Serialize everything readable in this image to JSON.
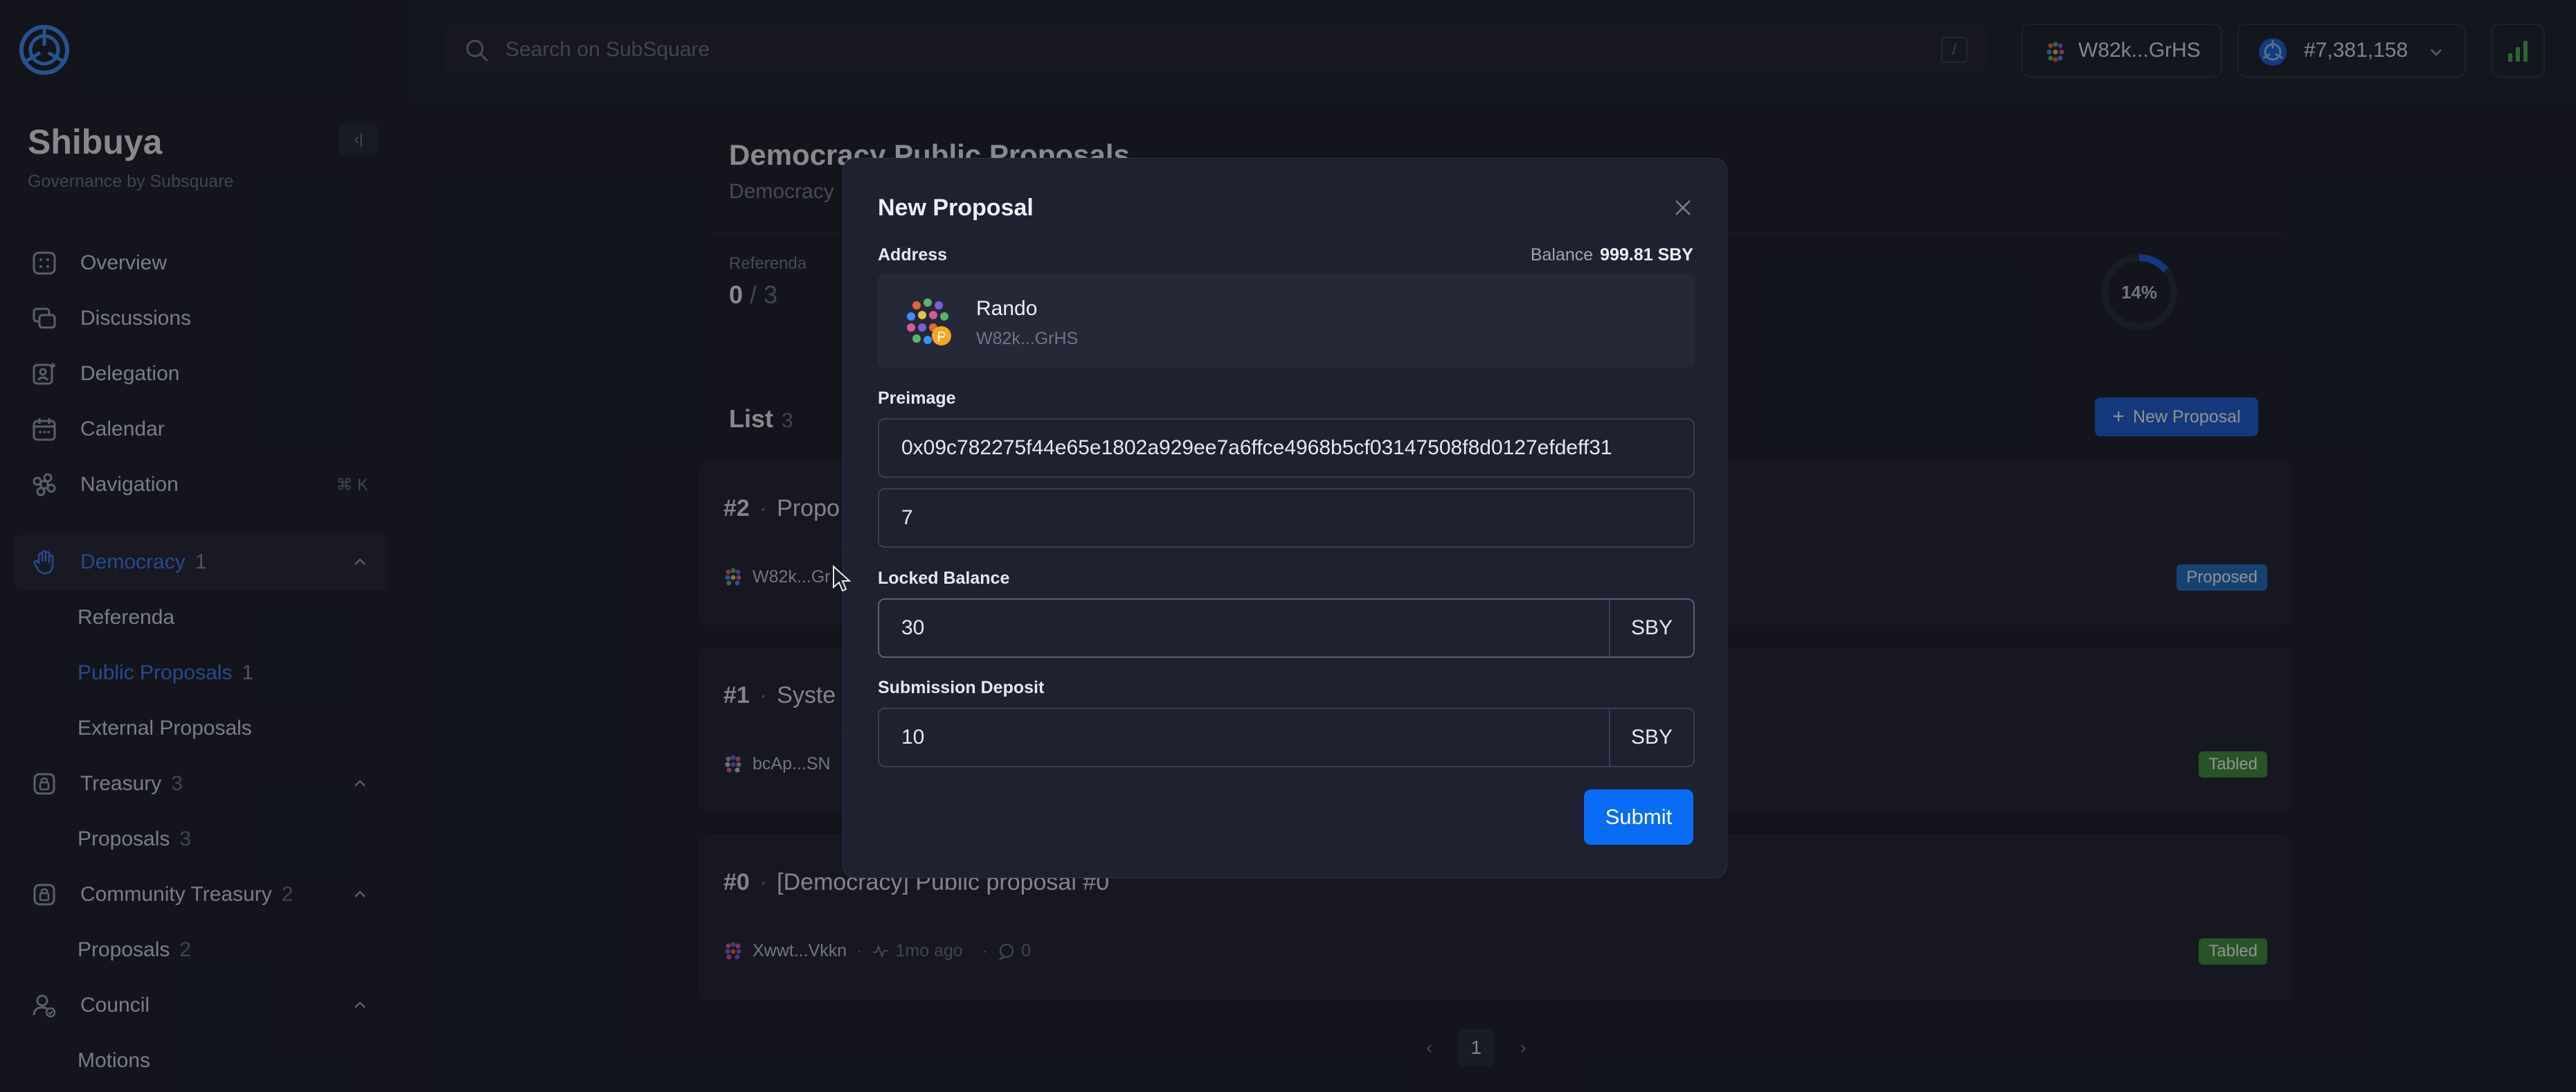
{
  "sidebar": {
    "chain_name": "Shibuya",
    "chain_sub": "Governance by Subsquare",
    "items": [
      {
        "label": "Overview",
        "icon": "overview-icon"
      },
      {
        "label": "Discussions",
        "icon": "discussions-icon"
      },
      {
        "label": "Delegation",
        "icon": "delegation-icon"
      },
      {
        "label": "Calendar",
        "icon": "calendar-icon"
      },
      {
        "label": "Navigation",
        "icon": "command-icon",
        "shortcut": "⌘ K"
      }
    ],
    "democracy": {
      "label": "Democracy",
      "count": "1",
      "subs": [
        {
          "label": "Referenda",
          "count": ""
        },
        {
          "label": "Public Proposals",
          "count": "1"
        },
        {
          "label": "External Proposals",
          "count": ""
        }
      ]
    },
    "treasury": {
      "label": "Treasury",
      "count": "3",
      "subs": [
        {
          "label": "Proposals",
          "count": "3"
        }
      ]
    },
    "community_treasury": {
      "label": "Community Treasury",
      "count": "2",
      "subs": [
        {
          "label": "Proposals",
          "count": "2"
        }
      ]
    },
    "council": {
      "label": "Council",
      "subs": [
        {
          "label": "Motions"
        }
      ]
    }
  },
  "header": {
    "search_placeholder": "Search on SubSquare",
    "search_shortcut": "/",
    "account": "W82k...GrHS",
    "block": "#7,381,158"
  },
  "page": {
    "title": "Democracy Public Proposals",
    "subtitle": "Democracy",
    "referenda_label": "Referenda",
    "referenda_value": "0",
    "referenda_total": "/ 3",
    "progress_label": "14%",
    "progress_fraction": 0.14,
    "list_label": "List",
    "list_count": "3",
    "new_proposal": "New Proposal",
    "proposals": [
      {
        "id": "#2",
        "title": "Propo",
        "author": "W82k...Gr",
        "status": "Proposed",
        "time": "",
        "comments": ""
      },
      {
        "id": "#1",
        "title": "Syste",
        "author": "bcAp...SN",
        "status": "Tabled",
        "time": "",
        "comments": ""
      },
      {
        "id": "#0",
        "title": "[Democracy] Public proposal #0",
        "author": "Xwwt...Vkkn",
        "status": "Tabled",
        "time": "1mo ago",
        "comments": "0"
      }
    ],
    "current_page": "1"
  },
  "modal": {
    "title": "New Proposal",
    "address_label": "Address",
    "balance_label": "Balance",
    "balance_value": "999.81 SBY",
    "account_name": "Rando",
    "account_addr": "W82k...GrHS",
    "preimage_label": "Preimage",
    "preimage_hash": "0x09c782275f44e65e1802a929ee7a6ffce4968b5cf03147508f8d0127efdeff31",
    "preimage_len": "7",
    "locked_label": "Locked Balance",
    "locked_value": "30",
    "locked_unit": "SBY",
    "deposit_label": "Submission Deposit",
    "deposit_value": "10",
    "deposit_unit": "SBY",
    "submit": "Submit"
  },
  "colors": {
    "accent": "#0a6cf5",
    "proposed": "#1e6fc1",
    "tabled": "#3f8f3a"
  }
}
